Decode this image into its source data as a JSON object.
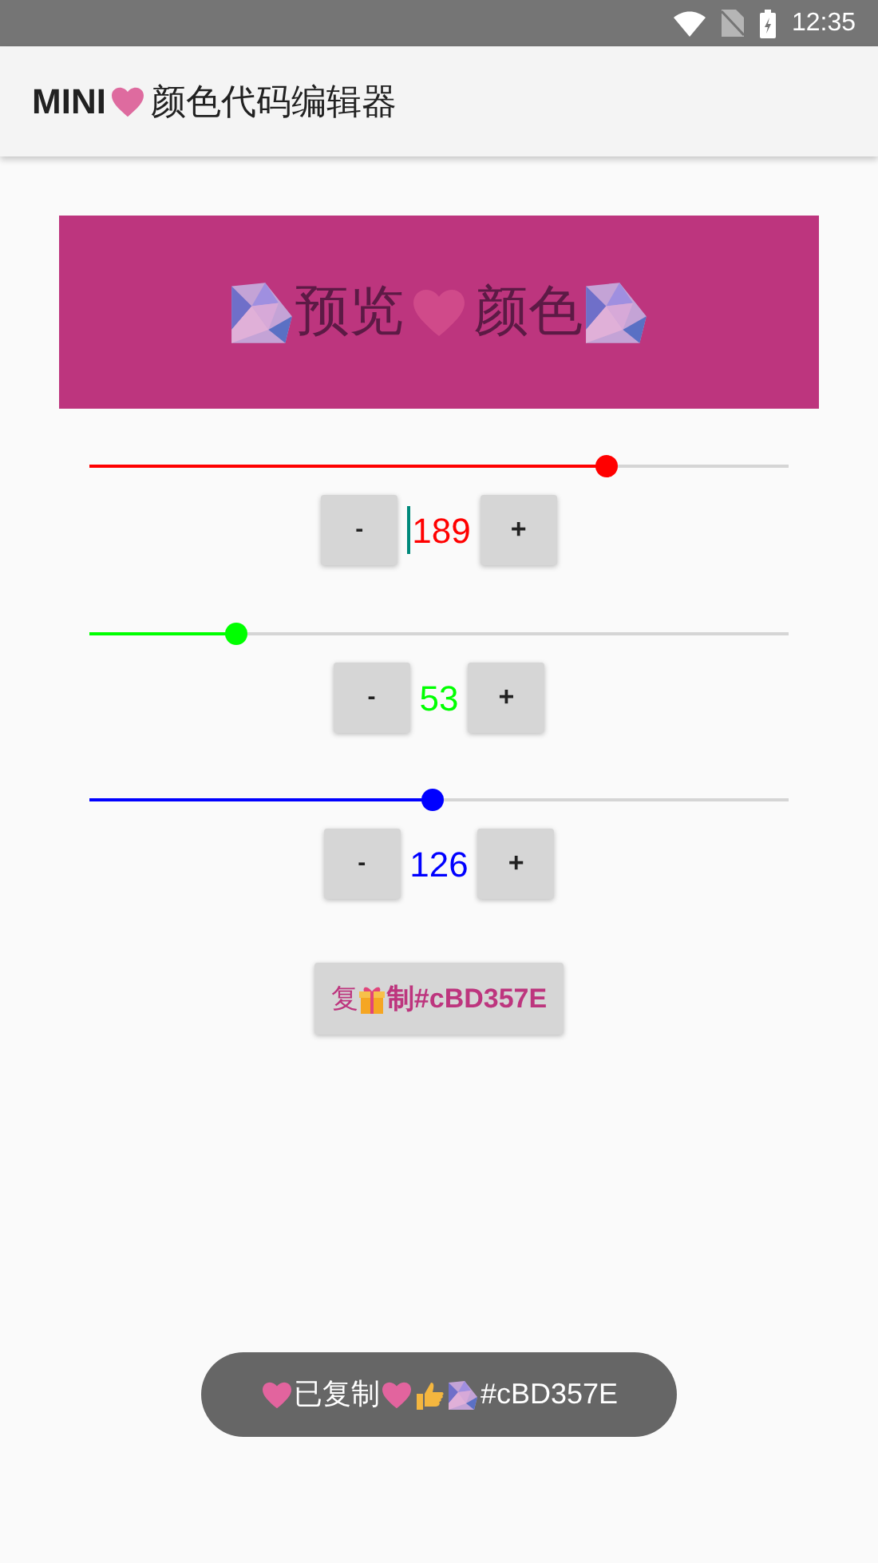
{
  "status_bar": {
    "time": "12:35"
  },
  "app_bar": {
    "title_prefix": "MINI",
    "title": "颜色代码编辑器"
  },
  "preview": {
    "color": "#bd357e",
    "text_left": "预览",
    "text_right": "颜色"
  },
  "channels": [
    {
      "color": "#ff0000",
      "level": 0.74,
      "value": "189",
      "focused": true,
      "minus": "-",
      "plus": "+"
    },
    {
      "color": "#00ff00",
      "level": 0.21,
      "value": "53",
      "focused": false,
      "minus": "-",
      "plus": "+"
    },
    {
      "color": "#0000ff",
      "level": 0.49,
      "value": "126",
      "focused": false,
      "minus": "-",
      "plus": "+"
    }
  ],
  "copy_button": {
    "prefix": "复",
    "label": "制#cBD357E"
  },
  "toast": {
    "message": "已复制",
    "code": "#cBD357E"
  }
}
